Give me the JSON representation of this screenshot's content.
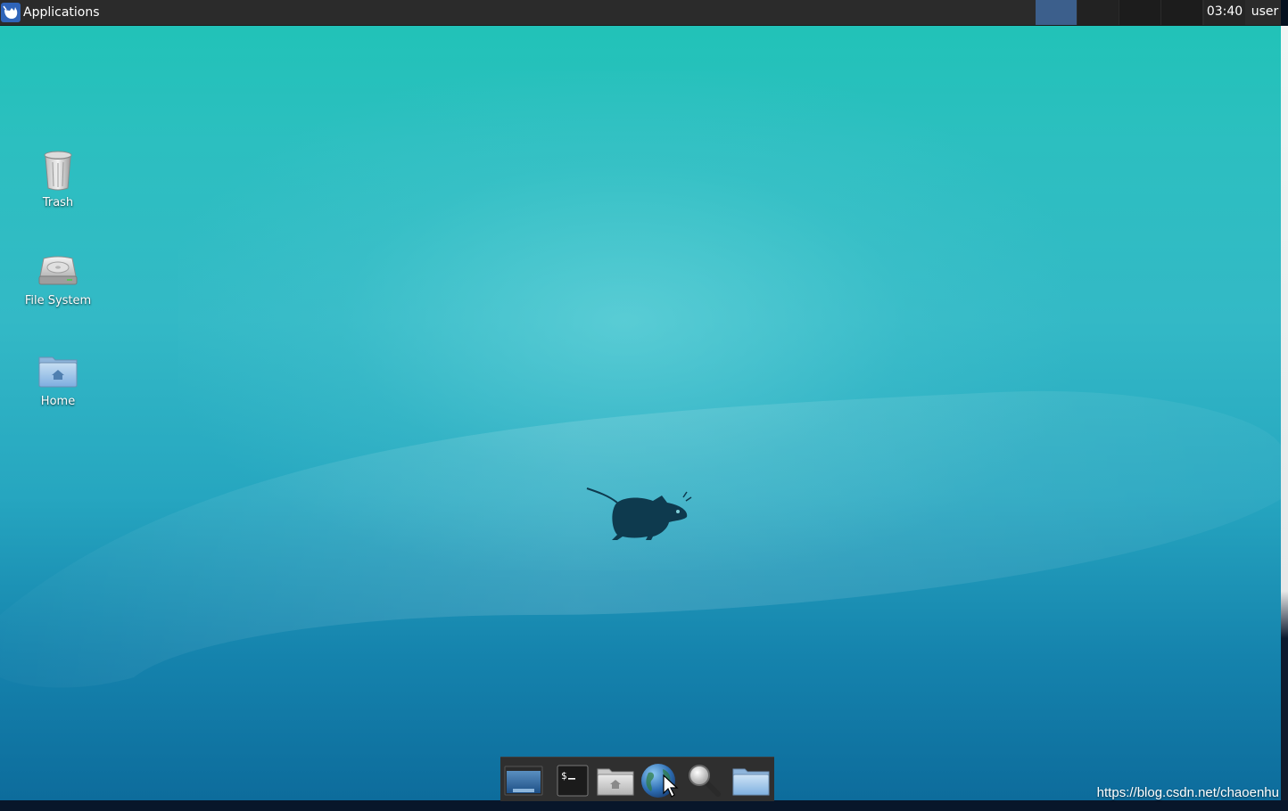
{
  "panel": {
    "applications_label": "Applications",
    "clock": "03:40",
    "user": "user",
    "workspaces": [
      {
        "id": 1,
        "active": true
      },
      {
        "id": 2,
        "active": false
      },
      {
        "id": 3,
        "active": false
      },
      {
        "id": 4,
        "active": false
      }
    ],
    "colors": {
      "background": "#2b2b2b",
      "active_workspace": "#3c5f8c"
    }
  },
  "desktop_icons": [
    {
      "label": "Trash",
      "icon": "trash-icon"
    },
    {
      "label": "File System",
      "icon": "hard-drive-icon"
    },
    {
      "label": "Home",
      "icon": "home-folder-icon"
    }
  ],
  "dock": {
    "items": [
      {
        "icon": "show-desktop-icon"
      },
      {
        "icon": "terminal-icon"
      },
      {
        "icon": "file-manager-icon"
      },
      {
        "icon": "web-browser-icon"
      },
      {
        "icon": "app-finder-icon"
      },
      {
        "icon": "folder-icon"
      }
    ]
  },
  "watermark": "https://blog.csdn.net/chaoenhu",
  "wallpaper": {
    "colors": [
      "#1fc3b6",
      "#33b9c6",
      "#1583ad",
      "#0d6c9c"
    ],
    "logo": "xfce-mouse-logo"
  }
}
